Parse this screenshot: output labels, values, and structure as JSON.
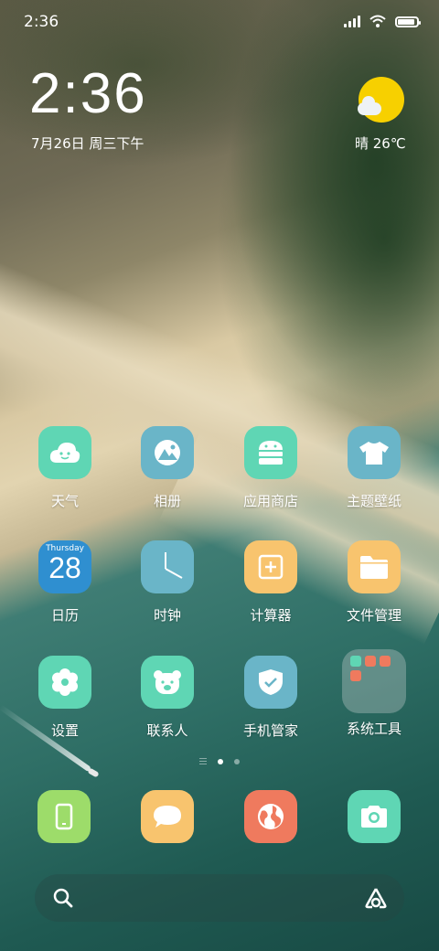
{
  "status_bar": {
    "time": "2:36"
  },
  "clock_widget": {
    "time": "2:36",
    "date": "7月26日 周三下午"
  },
  "weather_widget": {
    "text": "晴 26℃"
  },
  "apps": [
    {
      "label": "天气",
      "icon": "weather-cloud-icon",
      "color": "#5fd6b4"
    },
    {
      "label": "相册",
      "icon": "gallery-icon",
      "color": "#6ab5c8"
    },
    {
      "label": "应用商店",
      "icon": "app-store-icon",
      "color": "#5fd6b4"
    },
    {
      "label": "主题壁纸",
      "icon": "themes-tshirt-icon",
      "color": "#6ab5c8"
    },
    {
      "label": "日历",
      "icon": "calendar-icon",
      "color": "#2f8fd0",
      "weekday": "Thursday",
      "day": "28"
    },
    {
      "label": "时钟",
      "icon": "clock-icon",
      "color": "#6ab5c8"
    },
    {
      "label": "计算器",
      "icon": "calculator-icon",
      "color": "#f8c46e"
    },
    {
      "label": "文件管理",
      "icon": "folder-icon",
      "color": "#f8c46e"
    },
    {
      "label": "设置",
      "icon": "settings-gear-icon",
      "color": "#5fd6b4"
    },
    {
      "label": "联系人",
      "icon": "contacts-bear-icon",
      "color": "#5fd6b4"
    },
    {
      "label": "手机管家",
      "icon": "security-shield-icon",
      "color": "#6ab5c8"
    },
    {
      "label": "系统工具",
      "icon": "app-folder-icon",
      "color": "#c8d2d2"
    }
  ],
  "page_indicator": {
    "pages": 2,
    "active": 1
  },
  "dock": [
    {
      "icon": "phone-icon",
      "color": "#9ddc6a"
    },
    {
      "icon": "messages-icon",
      "color": "#f8c46e"
    },
    {
      "icon": "browser-globe-icon",
      "color": "#ef7a5e"
    },
    {
      "icon": "camera-icon",
      "color": "#5fd6b4"
    }
  ],
  "search_bar": {
    "left_icon": "search-icon",
    "right_icon": "assistant-icon"
  }
}
